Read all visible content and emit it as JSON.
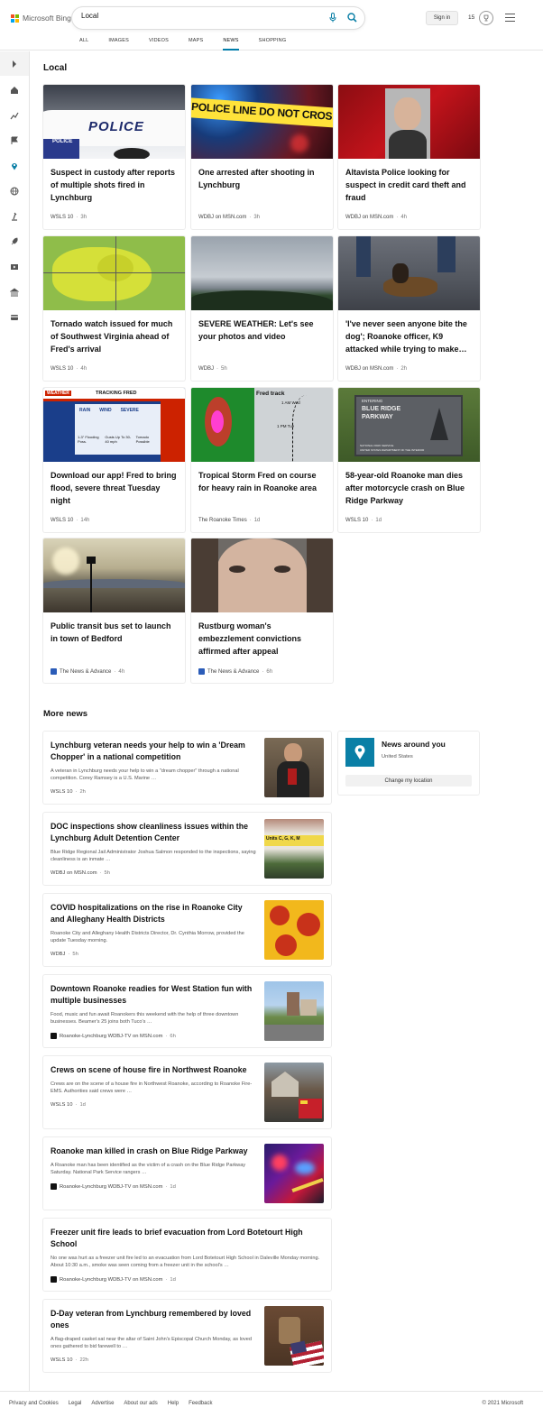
{
  "brand": {
    "name": "Microsoft Bing",
    "colors": [
      "#f25022",
      "#7fba00",
      "#00a4ef",
      "#ffb900"
    ]
  },
  "search": {
    "query": "Local"
  },
  "header": {
    "signin_label": "Sign in",
    "rewards_count": "15"
  },
  "tabs": [
    {
      "label": "ALL"
    },
    {
      "label": "IMAGES"
    },
    {
      "label": "VIDEOS"
    },
    {
      "label": "MAPS"
    },
    {
      "label": "NEWS",
      "active": true
    },
    {
      "label": "SHOPPING"
    }
  ],
  "accent_color": "#007daa",
  "sidebar_icons": [
    "expand-icon",
    "home-icon",
    "trending-icon",
    "flag-icon",
    "location-icon",
    "globe-icon",
    "science-icon",
    "rocket-icon",
    "video-icon",
    "bank-icon",
    "card-icon"
  ],
  "local": {
    "title": "Local",
    "cards": [
      {
        "title": "Suspect in custody after reports of multiple shots fired in Lynchburg",
        "source": "WSLS 10",
        "time": "3h",
        "image": "police-car"
      },
      {
        "title": "One arrested after shooting in Lynchburg",
        "source": "WDBJ on MSN.com",
        "time": "3h",
        "image": "police-tape"
      },
      {
        "title": "Altavista Police looking for suspect in credit card theft and fraud",
        "source": "WDBJ on MSN.com",
        "time": "4h",
        "image": "mugshot"
      },
      {
        "title": "Tornado watch issued for much of Southwest Virginia ahead of Fred's arrival",
        "source": "WSLS 10",
        "time": "4h",
        "image": "weather-map"
      },
      {
        "title": "SEVERE WEATHER: Let's see your photos and video",
        "source": "WDBJ",
        "time": "5h",
        "image": "storm-sky"
      },
      {
        "title": "'I've never seen anyone bite the dog'; Roanoke officer, K9 attacked while trying to make…",
        "source": "WDBJ on MSN.com",
        "time": "2h",
        "image": "k9-dog"
      },
      {
        "title": "Download our app! Fred to bring flood, severe threat Tuesday night",
        "source": "WSLS 10",
        "time": "14h",
        "image": "tracking-fred"
      },
      {
        "title": "Tropical Storm Fred on course for heavy rain in Roanoke area",
        "source": "The Roanoke Times",
        "time": "1d",
        "image": "radar-track"
      },
      {
        "title": "58-year-old Roanoke man dies after motorcycle crash on Blue Ridge Parkway",
        "source": "WSLS 10",
        "time": "1d",
        "image": "parkway-sign"
      },
      {
        "title": "Public transit bus set to launch in town of Bedford",
        "source": "The News & Advance",
        "time": "4h",
        "image": "bedford-town"
      },
      {
        "title": "Rustburg woman's embezzlement convictions affirmed after appeal",
        "source": "The News & Advance",
        "time": "6h",
        "image": "woman-face"
      }
    ],
    "image_text": {
      "police_door": "POLICE",
      "police_tape": "POLICE LINE DO NOT CROS",
      "weather_banner": "TRACKING FRED",
      "weather_brand": "WEATHER",
      "weather_cols": [
        "RAIN",
        "WIND",
        "SEVERE"
      ],
      "weather_vals": [
        "1-3\" Flooding Poss.",
        "Gusts Up To 30-40 mph",
        "Tornado Possible"
      ],
      "radar_label": "Fred track",
      "radar_times": [
        "1 AM Wed",
        "1 PM Tue"
      ],
      "parkway_sign": [
        "ENTERING",
        "BLUE RIDGE",
        "PARKWAY"
      ],
      "parkway_sub": [
        "NATIONAL PARK SERVICE",
        "UNITED STATES DEPARTMENT OF THE INTERIOR"
      ]
    }
  },
  "more_news": {
    "title": "More news",
    "items": [
      {
        "title": "Lynchburg veteran needs your help to win a 'Dream Chopper' in a national competition",
        "snippet": "A veteran in Lynchburg needs your help to win a \"dream chopper\" through a national competition. Corey Ramsey is a U.S. Marine …",
        "source": "WSLS 10",
        "time": "2h",
        "image": "veteran"
      },
      {
        "title": "DOC inspections show cleanliness issues within the Lynchburg Adult Detention Center",
        "snippet": "Blue Ridge Regional Jail Administrator Joshua Salmon responded to the inspections, saying cleanliness is an inmate …",
        "source": "WDBJ on MSN.com",
        "time": "5h",
        "image": "detention-center"
      },
      {
        "title": "COVID hospitalizations on the rise in Roanoke City and Alleghany Health Districts",
        "snippet": "Roanoke City and Alleghany Health Districts Director, Dr. Cynthia Morrow, provided the update Tuesday morning.",
        "source": "WDBJ",
        "time": "5h",
        "image": "virus"
      },
      {
        "title": "Downtown Roanoke readies for West Station fun with multiple businesses",
        "snippet": "Food, music and fun await Roanokers this weekend with the help of three downtown businesses. Beamer's 25 joins both Tuco's …",
        "source": "Roanoke-Lynchburg WDBJ-TV on MSN.com",
        "time": "6h",
        "image": "downtown"
      },
      {
        "title": "Crews on scene of house fire in Northwest Roanoke",
        "snippet": "Crews are on the scene of a house fire in Northwest Roanoke, according to Roanoke Fire-EMS. Authorities said crews were …",
        "source": "WSLS 10",
        "time": "1d",
        "image": "house-fire"
      },
      {
        "title": "Roanoke man killed in crash on Blue Ridge Parkway",
        "snippet": "A Roanoke man has been identified as the victim of a crash on the Blue Ridge Parkway Saturday. National Park Service rangers …",
        "source": "Roanoke-Lynchburg WDBJ-TV on MSN.com",
        "time": "1d",
        "image": "crash-lights"
      },
      {
        "title": "Freezer unit fire leads to brief evacuation from Lord Botetourt High School",
        "snippet": "No one was hurt as a freezer unit fire led to an evacuation from Lord Botetourt High School in Daleville Monday morning. About 10:30 a.m., smoke was seen coming from a freezer unit in the school's …",
        "source": "Roanoke-Lynchburg WDBJ-TV on MSN.com",
        "time": "1d",
        "image": "none"
      },
      {
        "title": "D-Day veteran from Lynchburg remembered by loved ones",
        "snippet": "A flag-draped casket sat near the altar of Saint John's Episcopal Church Monday, as loved ones gathered to bid farewell to …",
        "source": "WSLS 10",
        "time": "22h",
        "image": "church-flag"
      }
    ],
    "thumb_text": {
      "detention_sign": "Units C, G, K, M"
    }
  },
  "news_around": {
    "title": "News around you",
    "location": "United States",
    "button_label": "Change my location"
  },
  "footer": {
    "links": [
      "Privacy and Cookies",
      "Legal",
      "Advertise",
      "About our ads",
      "Help",
      "Feedback"
    ],
    "copyright": "© 2021 Microsoft"
  }
}
